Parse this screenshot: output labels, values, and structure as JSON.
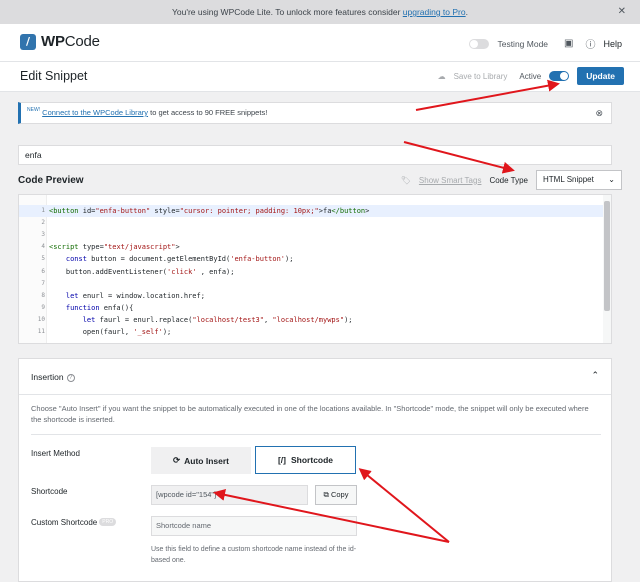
{
  "upgrade_bar": {
    "text": "You're using WPCode Lite. To unlock more features consider ",
    "link": "upgrading to Pro",
    "suffix": "."
  },
  "header": {
    "logo_wp": "WP",
    "logo_code": "Code",
    "testing_mode": "Testing Mode",
    "help": "Help"
  },
  "title_bar": {
    "title": "Edit Snippet",
    "save_to_library": "Save to Library",
    "active_label": "Active",
    "active": true,
    "update_button": "Update"
  },
  "notice": {
    "badge": "NEW!",
    "link": "Connect to the WPCode Library",
    "text": " to get access to 90 FREE snippets!"
  },
  "snippet_title": "enfa",
  "code_preview": {
    "label": "Code Preview",
    "show_smart_tags": "Show Smart Tags",
    "code_type_label": "Code Type",
    "code_type_value": "HTML Snippet"
  },
  "code_lines": [
    {
      "num": "1",
      "text": "<button id=\"enfa-button\" style=\"cursor: pointer; padding: 10px;\">fa</button>"
    },
    {
      "num": "2",
      "text": ""
    },
    {
      "num": "3",
      "text": ""
    },
    {
      "num": "4",
      "text": "<script type=\"text/javascript\">"
    },
    {
      "num": "5",
      "text": "    const button = document.getElementById('enfa-button');"
    },
    {
      "num": "6",
      "text": "    button.addEventListener('click' , enfa);"
    },
    {
      "num": "7",
      "text": ""
    },
    {
      "num": "8",
      "text": "    let enurl = window.location.href;"
    },
    {
      "num": "9",
      "text": "    function enfa(){"
    },
    {
      "num": "10",
      "text": "        let faurl = enurl.replace(\"localhost/test3\", \"localhost/mywps\");"
    },
    {
      "num": "11",
      "text": "        open(faurl, '_self');"
    }
  ],
  "insertion": {
    "title": "Insertion",
    "description": "Choose \"Auto Insert\" if you want the snippet to be automatically executed in one of the locations available. In \"Shortcode\" mode, the snippet will only be executed where the shortcode is inserted.",
    "insert_method_label": "Insert Method",
    "auto_insert": "Auto Insert",
    "shortcode": "Shortcode",
    "shortcode_label": "Shortcode",
    "shortcode_value": "[wpcode id=\"154\"]",
    "copy": "Copy",
    "custom_shortcode_label": "Custom Shortcode",
    "pro_badge": "PRO",
    "custom_placeholder": "Shortcode name",
    "custom_hint": "Use this field to define a custom shortcode name instead of the id-based one."
  },
  "colors": {
    "accent": "#2271b1",
    "annotation": "#e0161c"
  }
}
